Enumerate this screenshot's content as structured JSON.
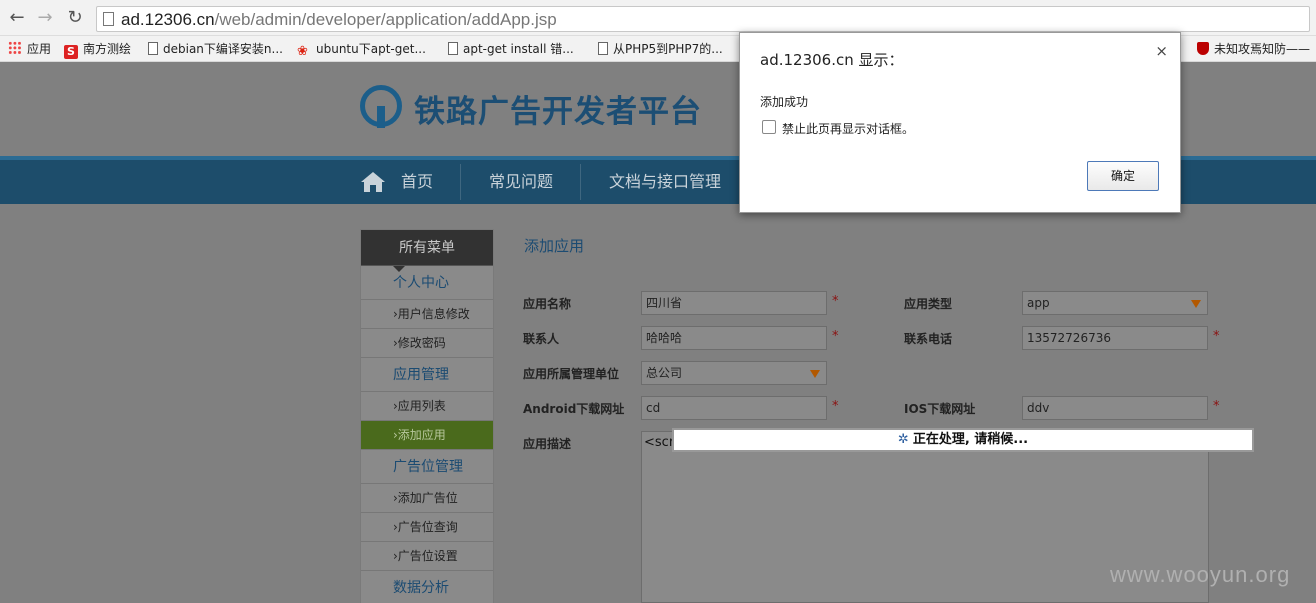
{
  "browser": {
    "url_host": "ad.12306.cn",
    "url_path": "/web/admin/developer/application/addApp.jsp",
    "bookmarks": [
      {
        "label": "应用",
        "icon": "apps-grid-icon"
      },
      {
        "label": "南方测绘",
        "icon": "s-logo-icon"
      },
      {
        "label": "debian下编译安装n...",
        "icon": "page-icon"
      },
      {
        "label": "ubuntu下apt-get...",
        "icon": "baidu-icon"
      },
      {
        "label": "apt-get install 错...",
        "icon": "page-icon"
      },
      {
        "label": "从PHP5到PHP7的...",
        "icon": "page-icon"
      },
      {
        "label": "未知攻焉知防——",
        "icon": "shield-icon"
      }
    ]
  },
  "site": {
    "logo_text": "铁路广告开发者平台",
    "nav": [
      "首页",
      "常见问题",
      "文档与接口管理"
    ]
  },
  "sidebar": {
    "header": "所有菜单",
    "groups": [
      {
        "label": "个人中心",
        "items": [
          "›用户信息修改",
          "›修改密码"
        ]
      },
      {
        "label": "应用管理",
        "items": [
          "›应用列表",
          "›添加应用"
        ]
      },
      {
        "label": "广告位管理",
        "items": [
          "›添加广告位",
          "›广告位查询",
          "›广告位设置"
        ]
      },
      {
        "label": "数据分析",
        "items": []
      }
    ],
    "active_item": "›添加应用"
  },
  "form": {
    "title": "添加应用",
    "app_name_label": "应用名称",
    "app_name_value": "四川省",
    "app_type_label": "应用类型",
    "app_type_value": "app",
    "contact_label": "联系人",
    "contact_value": "哈哈哈",
    "phone_label": "联系电话",
    "phone_value": "13572726736",
    "unit_label": "应用所属管理单位",
    "unit_value": "总公司",
    "android_label": "Android下载网址",
    "android_value": "cd",
    "ios_label": "IOS下载网址",
    "ios_value": "ddv",
    "desc_label": "应用描述",
    "desc_value": "<scr",
    "required_mark": "*"
  },
  "processing": {
    "text": "正在处理, 请稍候..."
  },
  "watermark": "www.wooyun.org",
  "dialog": {
    "title": "ad.12306.cn 显示：",
    "close": "×",
    "message": "添加成功",
    "checkbox_label": "禁止此页再显示对话框。",
    "ok_label": "确定"
  }
}
